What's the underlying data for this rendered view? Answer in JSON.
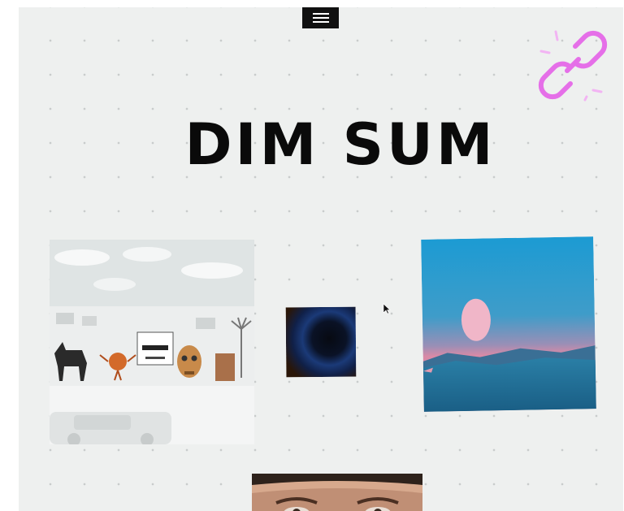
{
  "header": {
    "menu_icon": "hamburger-menu-icon",
    "link_icon": "broken-chain-link-icon",
    "title": "DIM SUM"
  },
  "gallery": {
    "items": [
      {
        "icon": "collage-artwork-street-scene"
      },
      {
        "icon": "dark-blue-eclipse-artwork"
      },
      {
        "icon": "pink-moon-ocean-artwork"
      },
      {
        "icon": "face-photo-artwork"
      }
    ]
  },
  "colors": {
    "background": "#eef0ef",
    "dot": "#c9cccc",
    "title": "#0a0a0a",
    "accent": "#e56fe8",
    "menu_bg": "#111111"
  }
}
